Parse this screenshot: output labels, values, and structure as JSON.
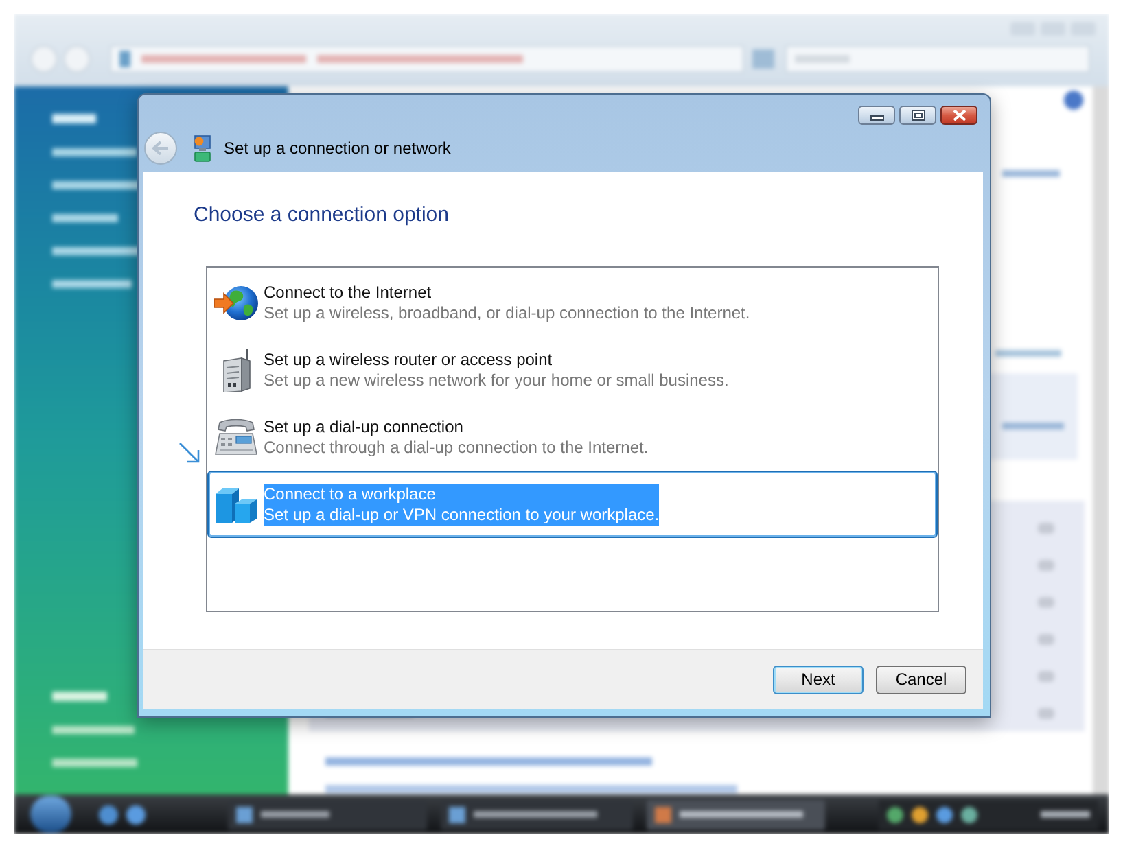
{
  "dialog": {
    "title": "Set up a connection or network",
    "heading": "Choose a connection option",
    "back_button": {
      "disabled": true
    }
  },
  "options": [
    {
      "kind": "internet",
      "title": "Connect to the Internet",
      "description": "Set up a wireless, broadband, or dial-up connection to the Internet.",
      "selected": false
    },
    {
      "kind": "router",
      "title": "Set up a wireless router or access point",
      "description": "Set up a new wireless network for your home or small business.",
      "selected": false
    },
    {
      "kind": "dialup",
      "title": "Set up a dial-up connection",
      "description": "Connect through a dial-up connection to the Internet.",
      "selected": false
    },
    {
      "kind": "workplace",
      "title": "Connect to a workplace",
      "description": "Set up a dial-up or VPN connection to your workplace.",
      "selected": true
    }
  ],
  "buttons": [
    {
      "label": "Next",
      "default": true
    },
    {
      "label": "Cancel",
      "default": false
    }
  ]
}
